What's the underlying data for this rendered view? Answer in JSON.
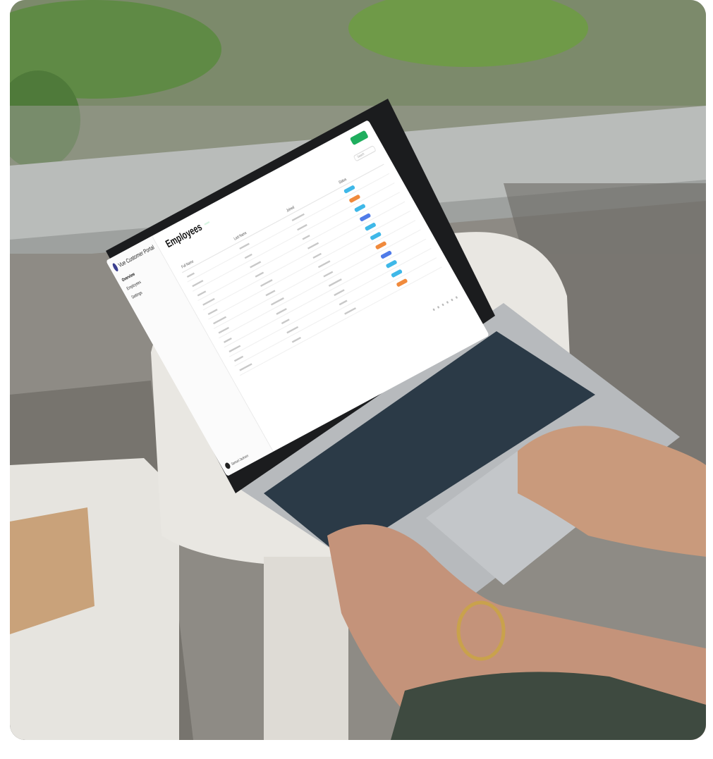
{
  "scene": {
    "description_tags": [
      "laptop",
      "hands",
      "keyboard",
      "table",
      "window",
      "plants"
    ]
  },
  "app": {
    "brand_name": "Vue Customer Portal",
    "nav": [
      {
        "label": "Overview",
        "active": true
      },
      {
        "label": "Employees",
        "active": false
      },
      {
        "label": "Settings",
        "active": false
      }
    ],
    "user_name": "Samuel Jackson"
  },
  "page": {
    "title": "Employees",
    "count_badge": "",
    "search_placeholder": "Search"
  },
  "table": {
    "columns": [
      "Full Name",
      "Last Name",
      "Joined",
      "Status"
    ],
    "rows": [
      {
        "status_color": "#3fb8e8"
      },
      {
        "status_color": "#f08a3c"
      },
      {
        "status_color": "#3fb8e8"
      },
      {
        "status_color": "#4f7be8"
      },
      {
        "status_color": "#3fb8e8"
      },
      {
        "status_color": "#3fb8e8"
      },
      {
        "status_color": "#f08a3c"
      },
      {
        "status_color": "#4f7be8"
      },
      {
        "status_color": "#3fb8e8"
      },
      {
        "status_color": "#3fb8e8"
      },
      {
        "status_color": "#f08a3c"
      }
    ]
  },
  "colors": {
    "accent": "#1fae5e",
    "brand": "#3b3f8f"
  }
}
